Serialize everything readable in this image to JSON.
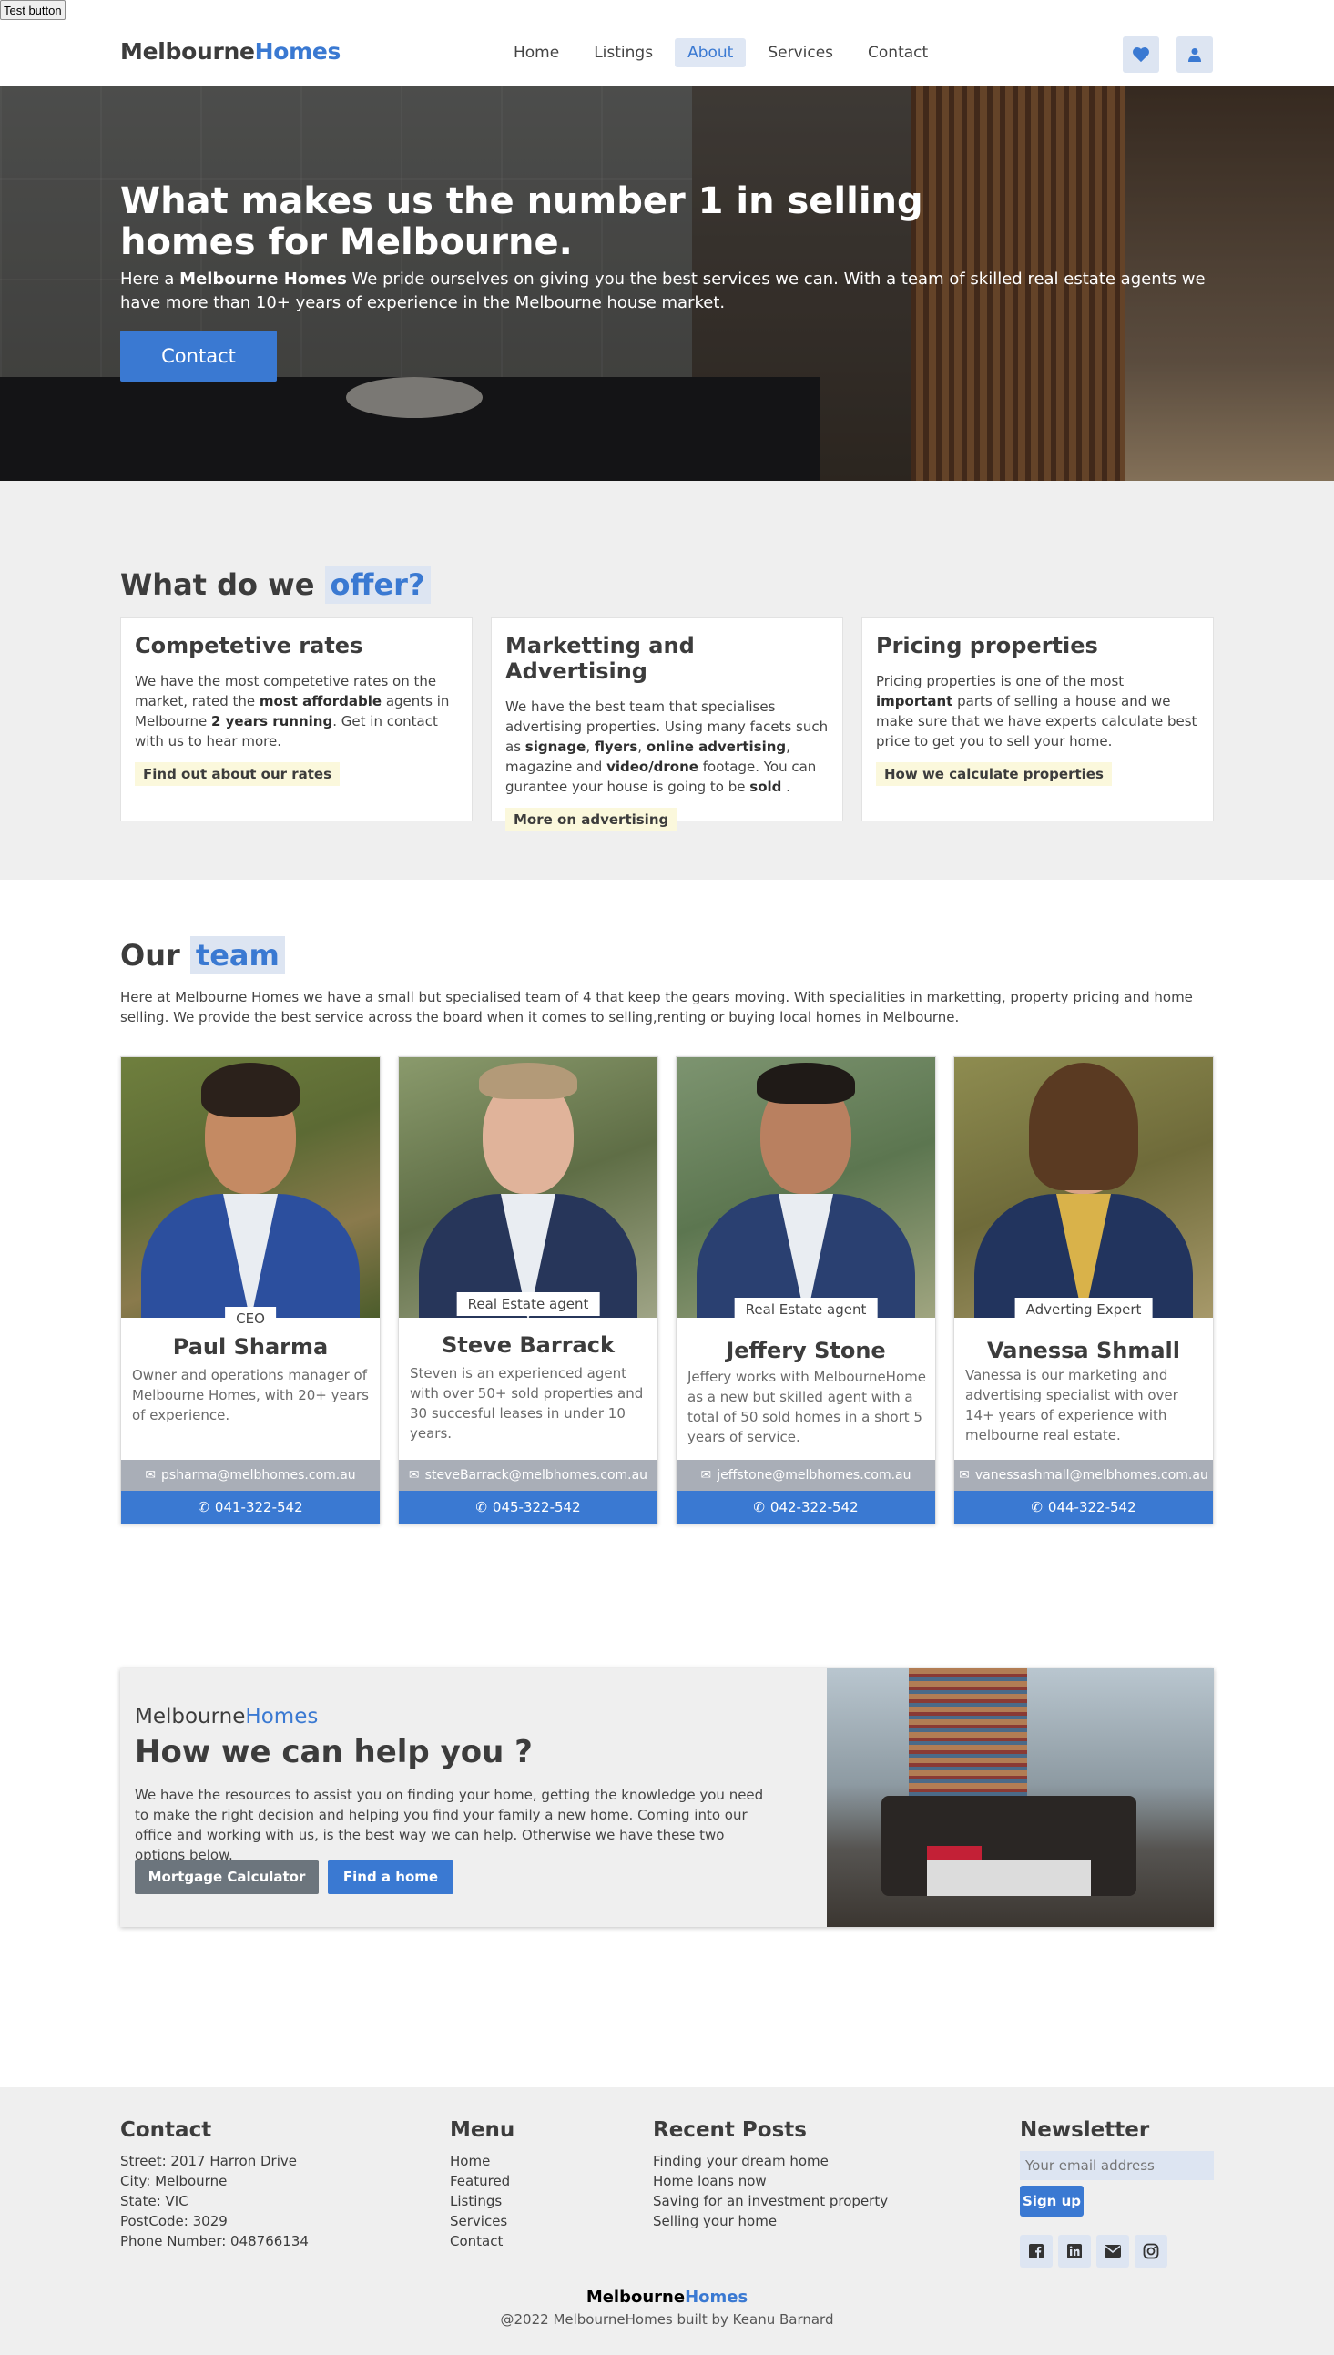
{
  "test_button": "Test button",
  "nav": {
    "logo_a": "Melbourne",
    "logo_b": "Homes",
    "items": [
      "Home",
      "Listings",
      "About",
      "Services",
      "Contact"
    ],
    "active": "About"
  },
  "hero": {
    "title": "What makes us the number 1 in selling homes for Melbourne.",
    "text_a": "Here a ",
    "text_bold": "Melbourne Homes",
    "text_b": " We pride ourselves on giving you the best services we can. With a team of skilled real estate agents we have more than 10+ years of experience in the Melbourne house market.",
    "cta": "Contact"
  },
  "offer": {
    "heading_a": "What do we",
    "heading_b": "offer?",
    "cards": [
      {
        "title": "Competetive rates",
        "t1": "We have the most competetive rates on the market, rated the ",
        "b1": "most affordable",
        "t2": " agents in Melbourne ",
        "b2": "2 years running",
        "t3": ". Get in contact with us to hear more.",
        "link": "Find out about our rates"
      },
      {
        "title": "Marketting and Advertising",
        "t1": "We have the best team that specialises advertising properties. Using many facets such as ",
        "b1": "signage",
        "t2": ", ",
        "b2": "flyers",
        "t3": ", ",
        "b3": "online advertising",
        "t4": ", magazine and ",
        "b4": "video/drone",
        "t5": " footage. You can gurantee your house is going to be ",
        "b5": "sold",
        "t6": " .",
        "link": "More on advertising"
      },
      {
        "title": "Pricing properties",
        "t1": "Pricing properties is one of the most ",
        "b1": "important",
        "t2": " parts of selling a house and we make sure that we have experts calculate best price to get you to sell your home.",
        "link": "How we calculate properties"
      }
    ]
  },
  "team": {
    "heading_a": "Our",
    "heading_b": "team",
    "intro": "Here at Melbourne Homes we have a small but specialised team of 4 that keep the gears moving. With specialities in marketting, property pricing and home selling. We provide the best service across the board when it comes to selling,renting or buying local homes in Melbourne.",
    "members": [
      {
        "role": "CEO",
        "name": "Paul Sharma",
        "desc": "Owner and operations manager of Melbourne Homes, with 20+ years of experience.",
        "email": "psharma@melbhomes.com.au",
        "phone": "041-322-542"
      },
      {
        "role": "Real Estate agent",
        "name": "Steve Barrack",
        "desc": "Steven is an experienced agent with over 50+ sold properties and 30 succesful leases in under 10 years.",
        "email": "steveBarrack@melbhomes.com.au",
        "phone": "045-322-542"
      },
      {
        "role": "Real Estate agent",
        "name": "Jeffery Stone",
        "desc": "Jeffery works with MelbourneHome as a new but skilled agent with a total of 50 sold homes in a short 5 years of service.",
        "email": "jeffstone@melbhomes.com.au",
        "phone": "042-322-542"
      },
      {
        "role": "Adverting Expert",
        "name": "Vanessa Shmall",
        "desc": "Vanessa is our marketing and advertising specialist with over 14+ years of experience with melbourne real estate.",
        "email": "vanessashmall@melbhomes.com.au",
        "phone": "044-322-542"
      }
    ]
  },
  "help": {
    "brand_a": "Melbourne",
    "brand_b": "Homes",
    "title": "How we can help you ?",
    "text": "We have the resources to assist you on finding your home, getting the knowledge you need to make the right decision and helping you find your family a new home. Coming into our office and working with us, is the best way we can help. Otherwise we have these two options below.",
    "btn_mortgage": "Mortgage Calculator",
    "btn_find": "Find a home"
  },
  "footer": {
    "contact_title": "Contact",
    "contact_lines": [
      "Street: 2017 Harron Drive",
      "City: Melbourne",
      "State: VIC",
      "PostCode: 3029",
      "Phone Number: 048766134"
    ],
    "menu_title": "Menu",
    "menu_items": [
      "Home",
      "Featured",
      "Listings",
      "Services",
      "Contact"
    ],
    "posts_title": "Recent Posts",
    "posts": [
      "Finding your dream home",
      "Home loans now",
      "Saving for an investment property",
      "Selling your home"
    ],
    "newsletter_title": "Newsletter",
    "email_placeholder": "Your email address",
    "signup": "Sign up",
    "social_icons": [
      "facebook-icon",
      "linkedin-icon",
      "mail-icon",
      "instagram-icon"
    ],
    "brand_a": "Melbourne",
    "brand_b": "Homes",
    "copyright": "@2022 MelbourneHomes built by Keanu Barnard"
  },
  "colors": {
    "accent": "#3a79d2",
    "accent_light": "#dde5f2",
    "section_bg": "#efefef",
    "highlight": "#fbf8dc"
  }
}
